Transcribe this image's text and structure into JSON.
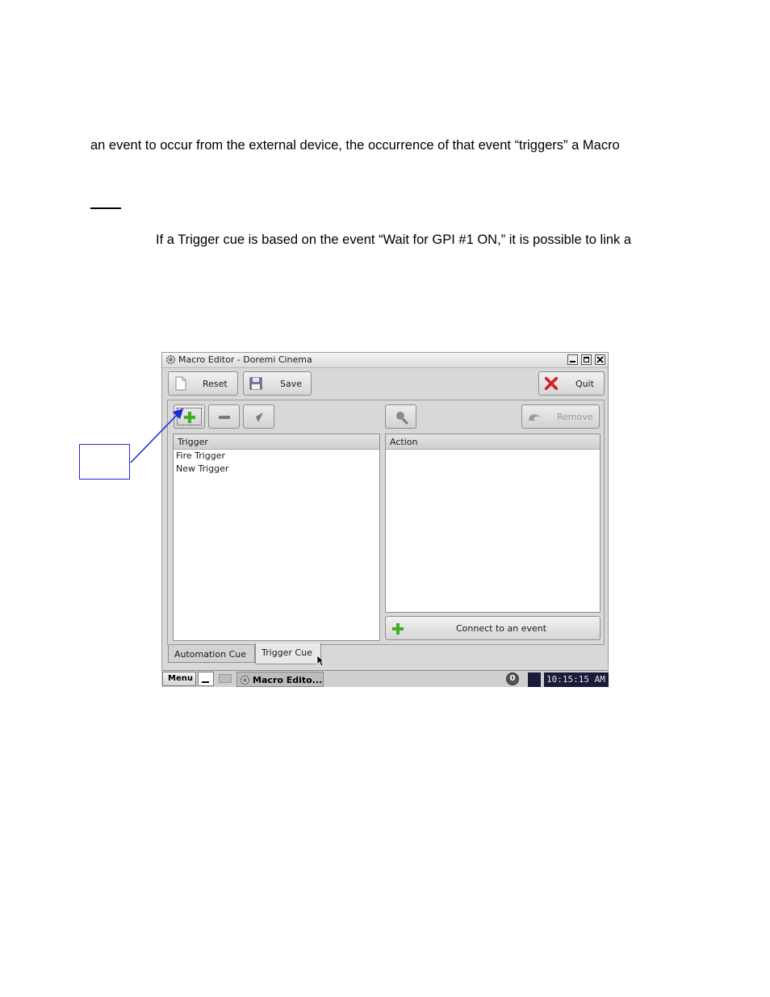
{
  "document": {
    "paragraph_1": "an event to occur from the external device, the occurrence of that event “triggers” a Macro",
    "paragraph_2": "If a Trigger cue is based on the event “Wait for GPI #1 ON,” it is possible to link a"
  },
  "window": {
    "title": "Macro Editor - Doremi Cinema",
    "toolbar": {
      "reset_label": "Reset",
      "save_label": "Save",
      "quit_label": "Quit"
    },
    "action_toolbar": {
      "remove_label": "Remove"
    },
    "trigger_list": {
      "header": "Trigger",
      "rows": [
        "Fire Trigger",
        "New Trigger"
      ]
    },
    "action_list": {
      "header": "Action"
    },
    "connect_label": "Connect to an event",
    "tabs": [
      "Automation Cue",
      "Trigger Cue"
    ]
  },
  "taskbar": {
    "menu_label": "Menu",
    "task_label": "Macro Edito...",
    "tray_label": "0",
    "clock": "10:15:15 AM"
  },
  "colors": {
    "callout": "#1e2bd6",
    "add_green": "#3fae1f",
    "quit_red": "#d42121"
  }
}
